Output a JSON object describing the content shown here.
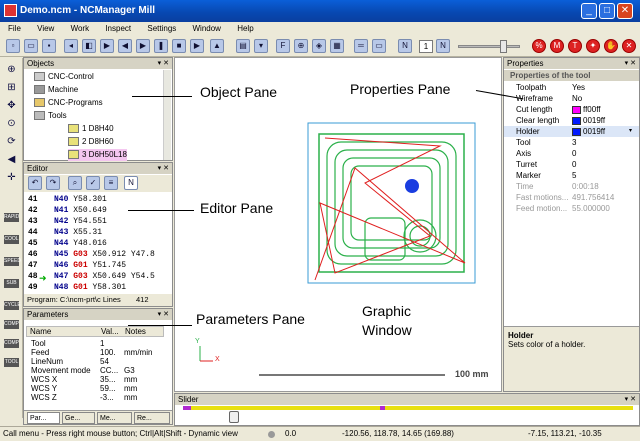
{
  "window": {
    "title": "Demo.ncm - NCManager Mill"
  },
  "menu": [
    "File",
    "View",
    "Work",
    "Inspect",
    "Settings",
    "Window",
    "Help"
  ],
  "toolbar": {
    "counter_value": "1"
  },
  "object_pane": {
    "title": "Objects",
    "items": [
      {
        "label": "CNC-Control",
        "type": "cnc-control"
      },
      {
        "label": "Machine",
        "type": "machine"
      },
      {
        "label": "CNC-Programs",
        "type": "cnc-programs"
      },
      {
        "label": "Tools",
        "type": "tools"
      },
      {
        "label": "1 D8H40",
        "type": "tool"
      },
      {
        "label": "2 D8H60",
        "type": "tool"
      },
      {
        "label": "3 D6H50L18",
        "type": "tool"
      }
    ]
  },
  "editor_pane": {
    "title": "Editor",
    "lines": [
      {
        "no": "41",
        "n": "N40",
        "rest": "Y58.301"
      },
      {
        "no": "42",
        "n": "N41",
        "rest": "X50.649"
      },
      {
        "no": "43",
        "n": "N42",
        "rest": "Y54.551"
      },
      {
        "no": "44",
        "n": "N43",
        "rest": "X55.31"
      },
      {
        "no": "45",
        "n": "N44",
        "rest": "Y48.016"
      },
      {
        "no": "46",
        "n": "N45",
        "g": "G03",
        "rest": "X50.912 Y47.8"
      },
      {
        "no": "47",
        "n": "N46",
        "g": "G01",
        "rest": "Y51.745"
      },
      {
        "no": "48",
        "n": "N47",
        "g": "G03",
        "rest": "X50.649 Y54.5"
      },
      {
        "no": "49",
        "n": "N48",
        "g": "G01",
        "rest": "Y58.301"
      }
    ],
    "footer": "Program: C:\\ncm-prt\\c Lines",
    "footer_count": "412"
  },
  "parameters_pane": {
    "title": "Parameters",
    "columns": [
      "Name",
      "Val...",
      "Notes"
    ],
    "rows": [
      [
        "Tool",
        "1",
        ""
      ],
      [
        "Feed",
        "100.",
        "mm/min"
      ],
      [
        "LineNum",
        "54",
        ""
      ],
      [
        "Movement mode",
        "CC...",
        "G3"
      ],
      [
        "WCS X",
        "35...",
        "mm"
      ],
      [
        "WCS Y",
        "59...",
        "mm"
      ],
      [
        "WCS Z",
        "-3...",
        "mm"
      ]
    ],
    "tabs": [
      "Par...",
      "Ge...",
      "Me...",
      "Re..."
    ]
  },
  "properties_pane": {
    "title": "Properties",
    "section": "Properties of the tool",
    "rows": [
      {
        "name": "Toolpath",
        "value": "Yes"
      },
      {
        "name": "Wireframe",
        "value": "No"
      },
      {
        "name": "Cut length",
        "value": "ff00ff",
        "color": "#ff00ff"
      },
      {
        "name": "Clear length",
        "value": "0019ff",
        "color": "#0019ff"
      },
      {
        "name": "Holder",
        "value": "0019ff",
        "color": "#0019ff"
      },
      {
        "name": "Tool",
        "value": "3"
      },
      {
        "name": "Axis",
        "value": "0"
      },
      {
        "name": "Turret",
        "value": "0"
      },
      {
        "name": "Marker",
        "value": "5"
      },
      {
        "name": "Time",
        "value": "0:00:18",
        "disabled": true
      },
      {
        "name": "Fast motions...",
        "value": "491.756414",
        "disabled": true
      },
      {
        "name": "Feed motion...",
        "value": "55.000000",
        "disabled": true
      }
    ],
    "help_title": "Holder",
    "help_text": "Sets color of a holder."
  },
  "slider_pane": {
    "title": "Slider"
  },
  "graphic": {
    "scale_label": "100 mm",
    "axis_x": "X",
    "axis_y": "Y"
  },
  "annotations": {
    "object_pane": "Object Pane",
    "editor_pane": "Editor Pane",
    "parameters_pane": "Parameters Pane",
    "properties_pane": "Properties Pane",
    "graphic_window": "Graphic\nWindow"
  },
  "statusbar": {
    "hint": "Call menu - Press right mouse button; Ctrl|Alt|Shift - Dynamic view",
    "value1": "0.0",
    "coords": "-120.56, 118.78, 14.65 (169.88)",
    "coords2": "-7.15, 113.21, -10.35"
  },
  "left_tool_labels": [
    "RAPID",
    "COOL",
    "SPEED",
    "SUB",
    "CYCLE",
    "COMP",
    "COMP",
    "TOOL"
  ]
}
